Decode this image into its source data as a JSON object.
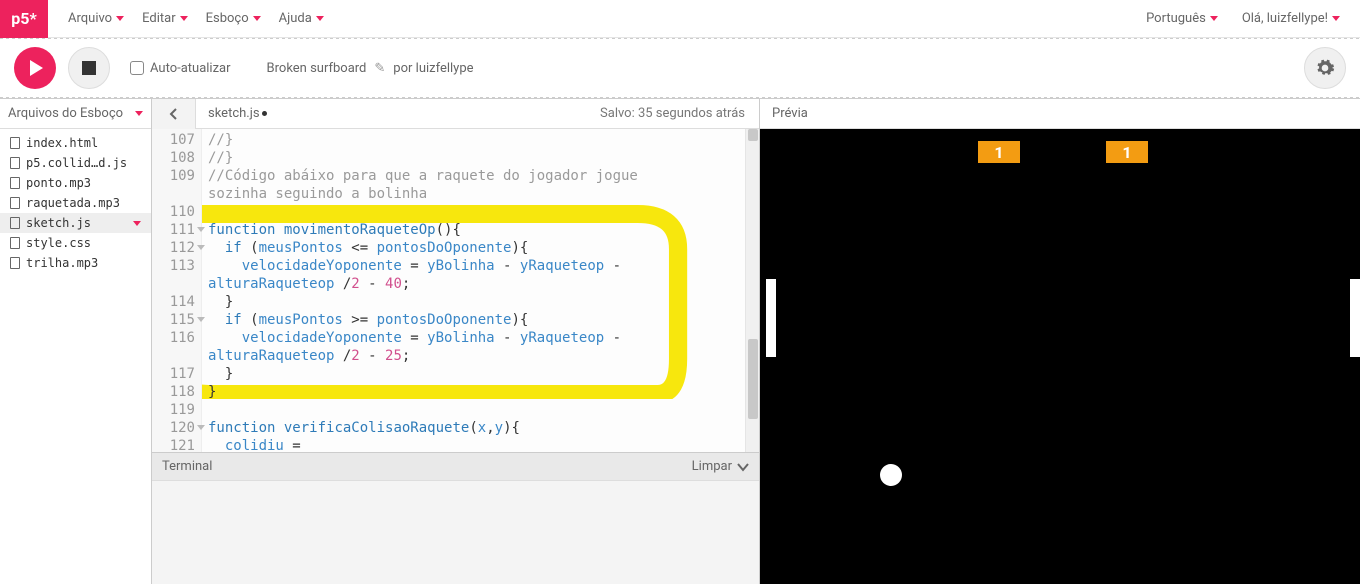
{
  "logo": "p5*",
  "menu": {
    "file": "Arquivo",
    "edit": "Editar",
    "sketch": "Esboço",
    "help": "Ajuda"
  },
  "right_menu": {
    "language": "Português",
    "greeting": "Olá, luizfellype!"
  },
  "toolbar": {
    "auto_refresh": "Auto-atualizar",
    "sketch_name": "Broken surfboard",
    "by": "por",
    "author": "luizfellype"
  },
  "sidebar": {
    "title": "Arquivos do Esboço",
    "files": [
      "index.html",
      "p5.collid…d.js",
      "ponto.mp3",
      "raquetada.mp3",
      "sketch.js",
      "style.css",
      "trilha.mp3"
    ],
    "selected": "sketch.js"
  },
  "editor": {
    "tab": "sketch.js",
    "saved": "Salvo: 35 segundos atrás",
    "line_start": 107,
    "lines": [
      {
        "n": 107,
        "t": "//}",
        "cls": "c-comment"
      },
      {
        "n": 108,
        "t": "//}",
        "cls": "c-comment"
      },
      {
        "n": 109,
        "t": "//Código abáixo para que a raquete do jogador jogue",
        "cls": "c-comment"
      },
      {
        "n": 0,
        "t": "sozinha seguindo a bolinha",
        "cls": "c-comment"
      },
      {
        "n": 110,
        "t": ""
      },
      {
        "n": 111,
        "fold": true,
        "html": "<span class='c-kw'>function</span> <span class='c-fn'>movimentoRaqueteOp</span>(){"
      },
      {
        "n": 112,
        "fold": true,
        "html": "  <span class='c-kw'>if</span> (<span class='c-id'>meusPontos</span> &lt;= <span class='c-id'>pontosDoOponente</span>){"
      },
      {
        "n": 113,
        "html": "    <span class='c-id'>velocidadeYoponente</span> = <span class='c-id'>yBolinha</span> - <span class='c-id'>yRaqueteop</span> -"
      },
      {
        "n": 0,
        "html": "<span class='c-id'>alturaRaqueteop</span> /<span class='c-num'>2</span> - <span class='c-num'>40</span>;"
      },
      {
        "n": 114,
        "t": "  }"
      },
      {
        "n": 115,
        "fold": true,
        "html": "  <span class='c-kw'>if</span> (<span class='c-id'>meusPontos</span> &gt;= <span class='c-id'>pontosDoOponente</span>){"
      },
      {
        "n": 116,
        "html": "    <span class='c-id'>velocidadeYoponente</span> = <span class='c-id'>yBolinha</span> - <span class='c-id'>yRaqueteop</span> -"
      },
      {
        "n": 0,
        "html": "<span class='c-id'>alturaRaqueteop</span> /<span class='c-num'>2</span> - <span class='c-num'>25</span>;"
      },
      {
        "n": 117,
        "t": "  }"
      },
      {
        "n": 118,
        "t": "}"
      },
      {
        "n": 119,
        "t": ""
      },
      {
        "n": 120,
        "fold": true,
        "html": "<span class='c-kw'>function</span> <span class='c-fn'>verificaColisaoRaquete</span>(<span class='c-id'>x</span>,<span class='c-id'>y</span>){"
      },
      {
        "n": 121,
        "html": "  <span class='c-id'>colidiu</span> ="
      }
    ]
  },
  "terminal": {
    "label": "Terminal",
    "clear": "Limpar"
  },
  "preview": {
    "label": "Prévia",
    "score_left": "1",
    "score_right": "1"
  }
}
